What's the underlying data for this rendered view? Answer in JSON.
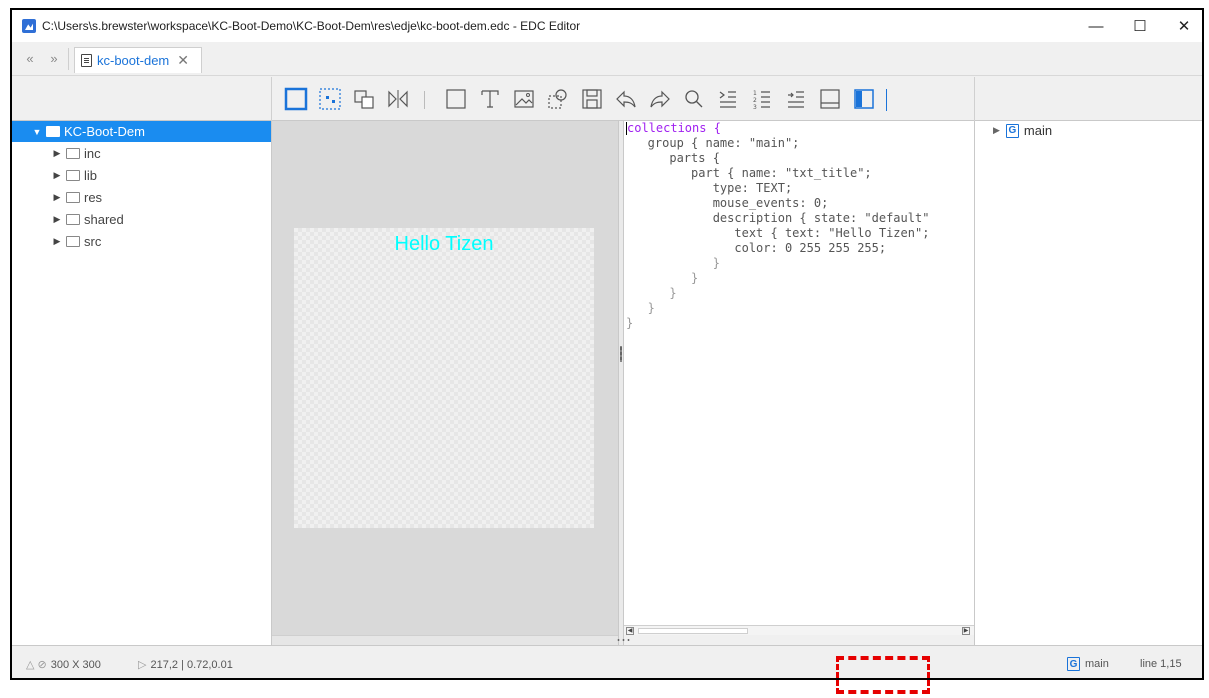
{
  "window": {
    "title": "C:\\Users\\s.brewster\\workspace\\KC-Boot-Demo\\KC-Boot-Dem\\res\\edje\\kc-boot-dem.edc - EDC Editor",
    "minimize": "—",
    "maximize": "☐",
    "close": "✕"
  },
  "tabbar": {
    "back": "«",
    "forward": "»",
    "tab_label": "kc-boot-dem",
    "tab_close": "✕"
  },
  "toolbar": {
    "icons": [
      "rect-select-icon",
      "part-select-icon",
      "layers-icon",
      "mirror-icon",
      "rectangle-part-icon",
      "text-part-icon",
      "image-part-icon",
      "spacer-part-icon",
      "save-icon",
      "undo-icon",
      "redo-icon",
      "find-icon",
      "wrap-icon",
      "line-numbers-icon",
      "indent-icon",
      "split-horizontal-icon",
      "split-vertical-icon"
    ]
  },
  "project_tree": {
    "root": "KC-Boot-Dem",
    "items": [
      "inc",
      "lib",
      "res",
      "shared",
      "src"
    ]
  },
  "preview": {
    "text": "Hello Tizen",
    "text_color": "#00ffff"
  },
  "code": {
    "lines": [
      "collections {",
      "   group { name: \"main\";",
      "      parts {",
      "         part { name: \"txt_title\";",
      "            type: TEXT;",
      "            mouse_events: 0;",
      "            description { state: \"default\"",
      "               text { text: \"Hello Tizen\";",
      "               color: 0 255 255 255;",
      "            }",
      "         }",
      "      }",
      "   }",
      "}"
    ]
  },
  "outline": {
    "item": "main"
  },
  "status": {
    "size": "300 X 300",
    "position": "217,2 | 0.72,0.01",
    "group": "main",
    "line": "line 1,15"
  },
  "colors": {
    "selection": "#1a8cf0",
    "accent": "#1a73d9",
    "highlight": "#e60000"
  }
}
